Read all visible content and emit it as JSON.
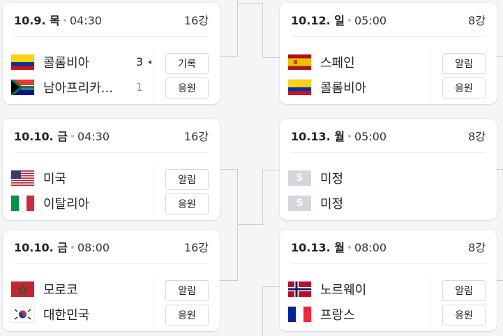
{
  "matches_left": [
    {
      "date": "10.9. 목",
      "time": "04:30",
      "round": "16강",
      "teams": [
        {
          "name": "콜롬비아",
          "flag": "colombia",
          "score": "3",
          "winner": true
        },
        {
          "name": "남아프리카...",
          "flag": "south-africa",
          "score": "1",
          "winner": false
        }
      ],
      "buttons": [
        "기록",
        "응원"
      ]
    },
    {
      "date": "10.10. 금",
      "time": "04:30",
      "round": "16강",
      "teams": [
        {
          "name": "미국",
          "flag": "usa"
        },
        {
          "name": "이탈리아",
          "flag": "italy"
        }
      ],
      "buttons": [
        "알림",
        "응원"
      ]
    },
    {
      "date": "10.10. 금",
      "time": "08:00",
      "round": "16강",
      "teams": [
        {
          "name": "모로코",
          "flag": "morocco"
        },
        {
          "name": "대한민국",
          "flag": "korea"
        }
      ],
      "buttons": [
        "알림",
        "응원"
      ]
    }
  ],
  "matches_right": [
    {
      "date": "10.12. 일",
      "time": "05:00",
      "round": "8강",
      "teams": [
        {
          "name": "스페인",
          "flag": "spain"
        },
        {
          "name": "콜롬비아",
          "flag": "colombia"
        }
      ],
      "buttons": [
        "알림",
        "응원"
      ]
    },
    {
      "date": "10.13. 월",
      "time": "05:00",
      "round": "8강",
      "teams": [
        {
          "name": "미정",
          "flag": "tbd",
          "flag_text": "S"
        },
        {
          "name": "미정",
          "flag": "tbd",
          "flag_text": "S"
        }
      ],
      "buttons": []
    },
    {
      "date": "10.13. 월",
      "time": "08:00",
      "round": "8강",
      "teams": [
        {
          "name": "노르웨이",
          "flag": "norway"
        },
        {
          "name": "프랑스",
          "flag": "france"
        }
      ],
      "buttons": [
        "알림",
        "응원"
      ]
    }
  ]
}
